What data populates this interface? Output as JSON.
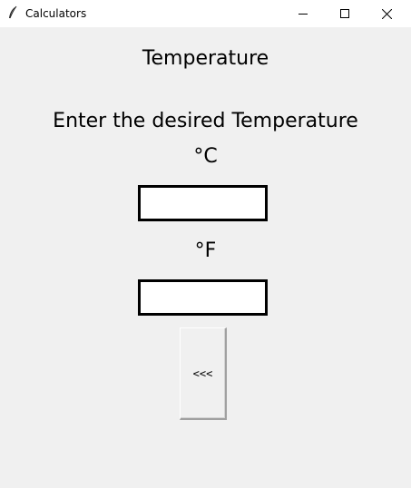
{
  "window": {
    "title": "Calculators",
    "icon": "feather-icon",
    "controls": [
      "minimize-icon",
      "maximize-icon",
      "close-icon"
    ]
  },
  "main": {
    "heading": "Temperature",
    "prompt": "Enter the desired Temperature",
    "celsius_label": "°C",
    "celsius_value": "",
    "fahrenheit_label": "°F",
    "fahrenheit_value": "",
    "back_button_label": "<<<"
  },
  "colors": {
    "background": "#f0f0f0",
    "titlebar": "#ffffff",
    "entry_border": "#000000"
  }
}
